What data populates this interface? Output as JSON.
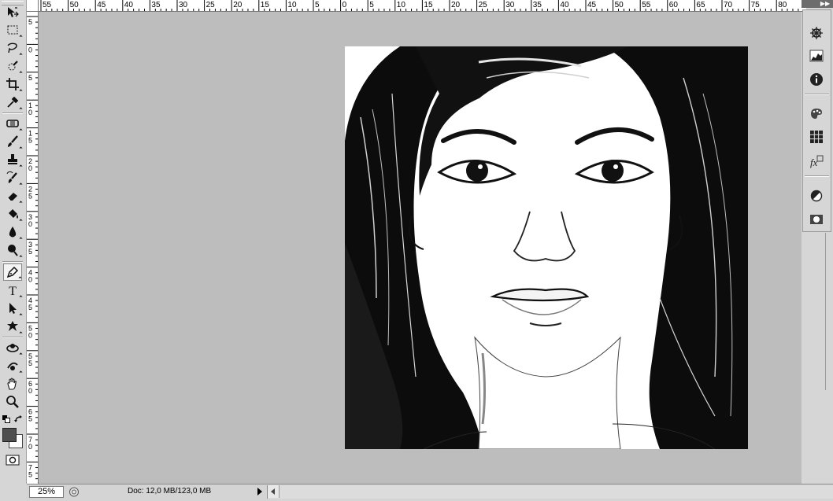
{
  "app": "Adobe Photoshop",
  "toolbar": {
    "tools": [
      {
        "name": "move-tool-icon"
      },
      {
        "name": "rectangular-marquee-tool-icon"
      },
      {
        "name": "lasso-tool-icon"
      },
      {
        "name": "quick-selection-tool-icon"
      },
      {
        "name": "crop-tool-icon"
      },
      {
        "name": "eyedropper-tool-icon"
      },
      {
        "name": "spot-healing-brush-tool-icon"
      },
      {
        "name": "brush-tool-icon"
      },
      {
        "name": "clone-stamp-tool-icon"
      },
      {
        "name": "history-brush-tool-icon"
      },
      {
        "name": "eraser-tool-icon"
      },
      {
        "name": "paint-bucket-tool-icon"
      },
      {
        "name": "blur-tool-icon"
      },
      {
        "name": "dodge-tool-icon"
      },
      {
        "name": "pen-tool-icon",
        "active": true
      },
      {
        "name": "type-tool-icon",
        "glyph": "T"
      },
      {
        "name": "path-selection-tool-icon"
      },
      {
        "name": "custom-shape-tool-icon"
      },
      {
        "name": "3d-rotate-tool-icon"
      },
      {
        "name": "3d-orbit-tool-icon"
      },
      {
        "name": "hand-tool-icon"
      },
      {
        "name": "zoom-tool-icon"
      }
    ],
    "foreground_color": "#4e4e4e",
    "background_color": "#ffffff"
  },
  "rulers": {
    "top_labels": [
      "55",
      "50",
      "45",
      "40",
      "35",
      "30",
      "25",
      "20",
      "15",
      "10",
      "5",
      "0",
      "5",
      "10",
      "15",
      "20",
      "25",
      "30",
      "35",
      "40",
      "45",
      "50",
      "55",
      "60",
      "65",
      "70",
      "75",
      "80"
    ],
    "left_labels": [
      "5",
      "0",
      "5",
      "1 0",
      "1 5",
      "2 0",
      "2 5",
      "3 0",
      "3 5",
      "4 0",
      "4 5",
      "5 0",
      "5 5",
      "6 0",
      "6 5",
      "7 0",
      "7 5"
    ]
  },
  "canvas": {
    "pasteboard_color": "#bdbdbd",
    "document_image": "black-and-white ink portrait of woman with long hair"
  },
  "dock": {
    "icons": [
      "navigator-icon",
      "histogram-icon",
      "info-icon",
      "color-icon",
      "swatches-icon",
      "styles-icon",
      "adjustments-icon",
      "masks-icon"
    ]
  },
  "status": {
    "zoom": "25%",
    "doc_info": "Doc: 12,0 MB/123,0 MB"
  }
}
